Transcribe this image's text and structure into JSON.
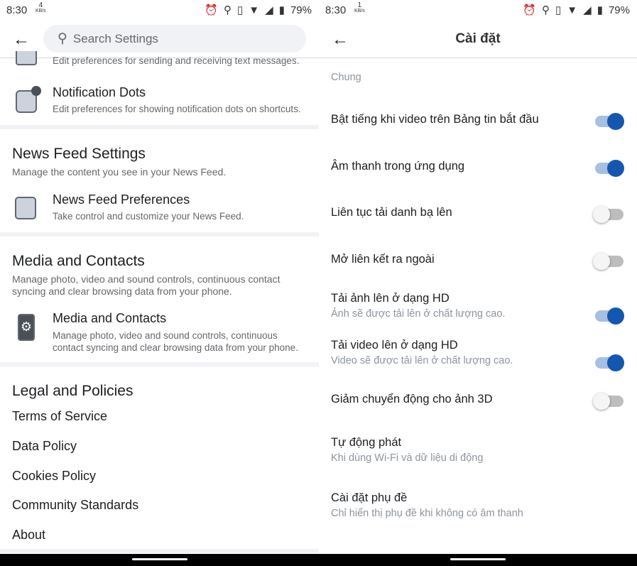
{
  "left": {
    "status": {
      "time": "8:30",
      "speed_value": "4",
      "speed_unit": "KB/s",
      "battery": "79%"
    },
    "search_placeholder": "Search Settings",
    "partial_item_subtitle": "Edit preferences for sending and receiving text messages.",
    "notification_dots": {
      "title": "Notification Dots",
      "subtitle": "Edit preferences for showing notification dots on shortcuts."
    },
    "news_feed": {
      "heading": "News Feed Settings",
      "desc": "Manage the content you see in your News Feed.",
      "item_title": "News Feed Preferences",
      "item_subtitle": "Take control and customize your News Feed."
    },
    "media": {
      "heading": "Media and Contacts",
      "desc1": "Manage photo, video and sound controls, continuous contact",
      "desc2": "syncing and clear browsing data from your phone.",
      "item_title": "Media and Contacts",
      "item_sub1": "Manage photo, video and sound controls, continuous",
      "item_sub2": "contact syncing and clear browsing data from your phone."
    },
    "legal": {
      "heading": "Legal and Policies",
      "links": [
        "Terms of Service",
        "Data Policy",
        "Cookies Policy",
        "Community Standards",
        "About"
      ]
    }
  },
  "right": {
    "status": {
      "time": "8:30",
      "speed_value": "1",
      "speed_unit": "KB/s",
      "battery": "79%"
    },
    "title": "Cài đặt",
    "section": "Chung",
    "rows": [
      {
        "title": "Bật tiếng khi video trên Bảng tin bắt đầu",
        "toggle": true
      },
      {
        "title": "Âm thanh trong ứng dụng",
        "toggle": true
      },
      {
        "title": "Liên tục tải danh bạ lên",
        "toggle": false
      },
      {
        "title": "Mở liên kết ra ngoài",
        "toggle": false
      },
      {
        "title": "Tải ảnh lên ở dạng HD",
        "subtitle": "Ảnh sẽ được tải lên ở chất lượng cao.",
        "toggle": true
      },
      {
        "title": "Tải video lên ở dạng HD",
        "subtitle": "Video sẽ được tải lên ở chất lượng cao.",
        "toggle": true
      },
      {
        "title": "Giảm chuyển động cho ảnh 3D",
        "toggle": false
      },
      {
        "title": "Tự động phát",
        "subtitle": "Khi dùng Wi-Fi và dữ liệu di động"
      },
      {
        "title": "Cài đặt phụ đề",
        "subtitle": "Chỉ hiển thị phụ đề khi không có âm thanh"
      }
    ]
  },
  "colors": {
    "accent": "#1457b0",
    "toggle_track_on": "#a6bfe3",
    "band": "#f0f2f5"
  }
}
